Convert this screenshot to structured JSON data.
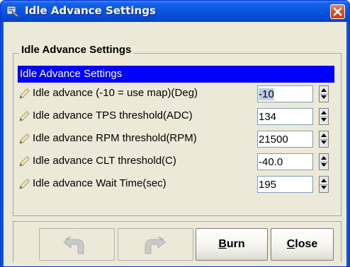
{
  "window": {
    "title": "Idle Advance Settings",
    "title_bar_color": "#0a55e0",
    "icon": "settings-app-icon"
  },
  "group": {
    "legend": "Idle Advance Settings",
    "section_header": "Idle Advance Settings",
    "section_header_color": "#0000ff"
  },
  "rows": [
    {
      "label": "Idle advance (-10 = use map)(Deg)",
      "value": "-10",
      "icon": "pencil-icon"
    },
    {
      "label": "Idle advance TPS threshold(ADC)",
      "value": "134",
      "icon": "pencil-icon"
    },
    {
      "label": "Idle advance RPM threshold(RPM)",
      "value": "21500",
      "icon": "pencil-icon"
    },
    {
      "label": "Idle advance CLT threshold(C)",
      "value": "-40.0",
      "icon": "pencil-icon"
    },
    {
      "label": "Idle advance Wait Time(sec)",
      "value": "195",
      "icon": "pencil-icon"
    }
  ],
  "buttons": {
    "undo_icon": "undo-icon",
    "redo_icon": "redo-icon",
    "burn_first": "B",
    "burn_rest": "urn",
    "close_first": "C",
    "close_rest": "lose"
  }
}
